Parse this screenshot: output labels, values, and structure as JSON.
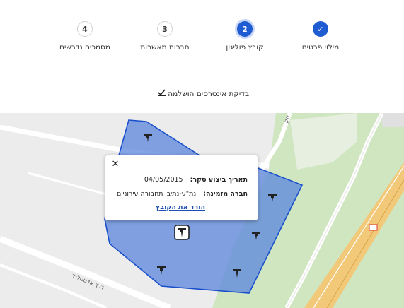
{
  "stepper": {
    "steps": [
      {
        "number": "✓",
        "label": "מילוי פרטים"
      },
      {
        "number": "2",
        "label": "קובץ פוליגון"
      },
      {
        "number": "3",
        "label": "חברות מאשרות"
      },
      {
        "number": "4",
        "label": "מסמכים נדרשים"
      }
    ]
  },
  "status": {
    "text": "בדיקת אינטרסים הושלמה"
  },
  "map": {
    "street_label_1": "דרך אלטנולנד",
    "street_label_2": "קק"
  },
  "popup": {
    "close_label": "✕",
    "date_key": "תאריך ביצוע סקר:",
    "date_value": "04/05/2015",
    "company_key": "חברה מזמינה:",
    "company_value": "נת\"ע-נתיבי תחבורה עירוניים",
    "download_link": "הורד את הקובץ"
  },
  "colors": {
    "accent": "#1f5bd1",
    "polygon_fill": "#5b86de",
    "polygon_stroke": "#1a4fcc"
  }
}
